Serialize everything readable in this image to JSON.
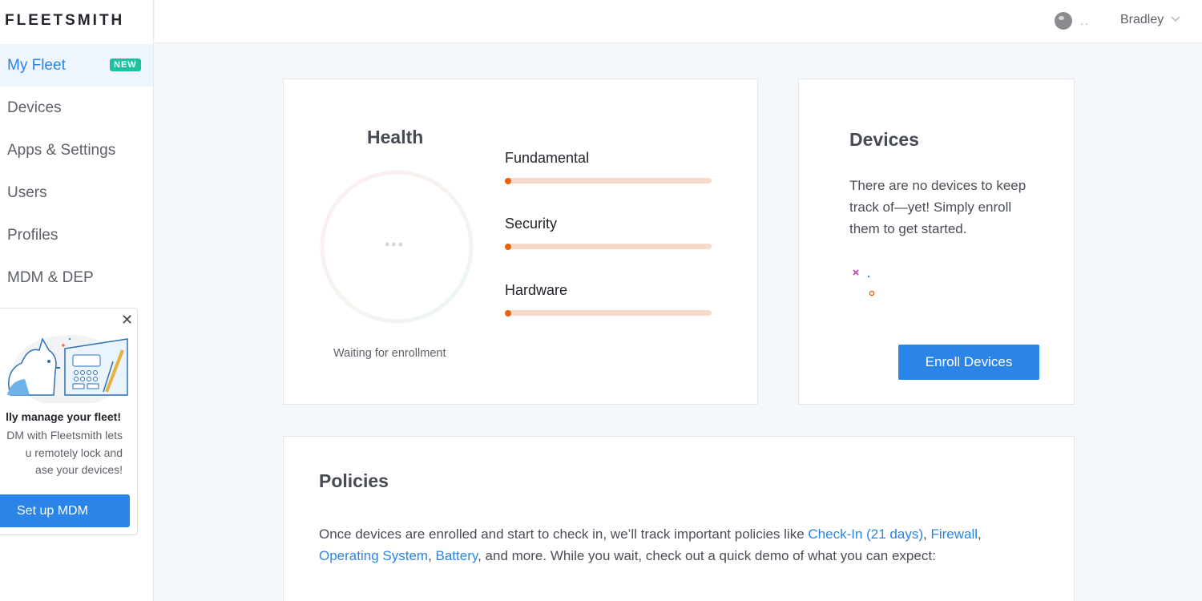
{
  "app": {
    "logo": "FLEETSMITH"
  },
  "sidebar": {
    "items": [
      {
        "label": "My Fleet",
        "badge": "NEW",
        "active": true
      },
      {
        "label": "Devices"
      },
      {
        "label": "Apps & Settings"
      },
      {
        "label": "Users"
      },
      {
        "label": "Profiles"
      },
      {
        "label": "MDM & DEP"
      }
    ],
    "promo": {
      "title": "lly manage your fleet!",
      "text_lines": [
        "DM with Fleetsmith lets",
        "u remotely lock and",
        "ase your devices!"
      ],
      "button_label": "Set up MDM",
      "close_icon": "close-icon",
      "illustration": "dog-with-control-panel"
    }
  },
  "topbar": {
    "user_name": "Bradley",
    "avatar_icon": "avatar-icon",
    "dropdown_icon": "chevron-down-icon"
  },
  "health": {
    "title": "Health",
    "status": "Waiting for enrollment",
    "ring_dots": "•••",
    "metrics": [
      {
        "label": "Fundamental",
        "progress": 0
      },
      {
        "label": "Security",
        "progress": 0
      },
      {
        "label": "Hardware",
        "progress": 0
      }
    ],
    "colors": {
      "bar_track": "#f6d9c8",
      "bar_fill": "#e5650d"
    }
  },
  "devices": {
    "title": "Devices",
    "text": "There are no devices to keep track of—yet! Simply enroll them to get started.",
    "button_label": "Enroll Devices"
  },
  "policies": {
    "title": "Policies",
    "text_before": "Once devices are enrolled and start to check in, we’ll track important policies like ",
    "links": [
      "Check-In (21 days)",
      "Firewall",
      "Operating System",
      "Battery"
    ],
    "text_after": ", and more. While you wait, check out a quick demo of what you can expect:"
  },
  "colors": {
    "accent": "#2b84e7",
    "badge": "#1fc0a2"
  }
}
